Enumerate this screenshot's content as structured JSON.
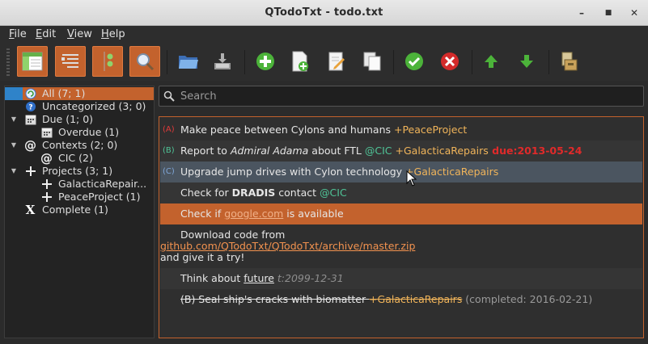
{
  "window": {
    "title": "QTodoTxt - todo.txt",
    "minimize": "–",
    "maximize": "■",
    "close": "✕"
  },
  "menu": [
    {
      "label": "File",
      "mnemonic": "F",
      "rest": "ile"
    },
    {
      "label": "Edit",
      "mnemonic": "E",
      "rest": "dit"
    },
    {
      "label": "View",
      "mnemonic": "V",
      "rest": "iew"
    },
    {
      "label": "Help",
      "mnemonic": "H",
      "rest": "elp"
    }
  ],
  "toolbar": {
    "buttons": [
      "show-filters-panel",
      "toggle-toolbar-layout",
      "show-completed-toggle",
      "show-search",
      "open-file",
      "save-file",
      "add-task",
      "add-task-alt",
      "edit-task",
      "copy-task",
      "complete-task",
      "delete-task",
      "increase-priority",
      "decrease-priority",
      "archive-completed"
    ],
    "accent": "#c3622d"
  },
  "sidebar": {
    "items": [
      {
        "label": "All (7; 1)",
        "icon": "refresh-icon",
        "selected": true
      },
      {
        "label": "Uncategorized (3; 0)",
        "icon": "help-icon"
      },
      {
        "label": "Due (1; 0)",
        "icon": "calendar-icon"
      },
      {
        "label": "Overdue (1)",
        "icon": "calendar-icon"
      },
      {
        "label": "Contexts (2; 0)",
        "icon": "at-icon"
      },
      {
        "label": "CIC (2)",
        "icon": "at-icon"
      },
      {
        "label": "Projects (3; 1)",
        "icon": "plus-icon"
      },
      {
        "label": "GalacticaRepair...",
        "icon": "plus-icon"
      },
      {
        "label": "PeaceProject (1)",
        "icon": "plus-icon"
      },
      {
        "label": "Complete (1)",
        "icon": "x-icon"
      }
    ]
  },
  "search": {
    "placeholder": "Search"
  },
  "tasks": {
    "t1": {
      "prio": "(A)",
      "text": "Make peace between Cylons and humans ",
      "project": "+PeaceProject"
    },
    "t2": {
      "prio": "(B)",
      "pre": "Report to ",
      "em": "Admiral Adama",
      "mid": " about FTL ",
      "context": "@CIC",
      "project": " +GalacticaRepairs",
      "due": " due:2013-05-24"
    },
    "t3": {
      "prio": "(C)",
      "text": "Upgrade jump drives with Cylon technology ",
      "project": "+GalacticaRepairs"
    },
    "t4": {
      "pre": "Check for ",
      "strong": "DRADIS",
      "mid": " contact ",
      "context": "@CIC"
    },
    "t5": {
      "pre": "Check if ",
      "link": "google.com",
      "post": " is available"
    },
    "t6": {
      "line1": "Download code from",
      "link": "github.com/QTodoTxt/QTodoTxt/archive/master.zip",
      "line3": "and give it a try!"
    },
    "t7": {
      "pre": "Think about ",
      "link": "future",
      "threshold": " t:2099-12-31"
    },
    "t8": {
      "text": "(B) Seal ship's cracks with biomatter ",
      "project": "+GalacticaRepairs",
      "completed": " (completed: 2016-02-21)"
    }
  },
  "colors": {
    "priority_a": "#e03a3a",
    "priority_b": "#4fc497",
    "priority_c": "#7fa7d8",
    "project": "#f0b45a",
    "context": "#4fc497",
    "due": "#e02a2a",
    "selection": "#c3622d",
    "link": "#f2924f"
  }
}
